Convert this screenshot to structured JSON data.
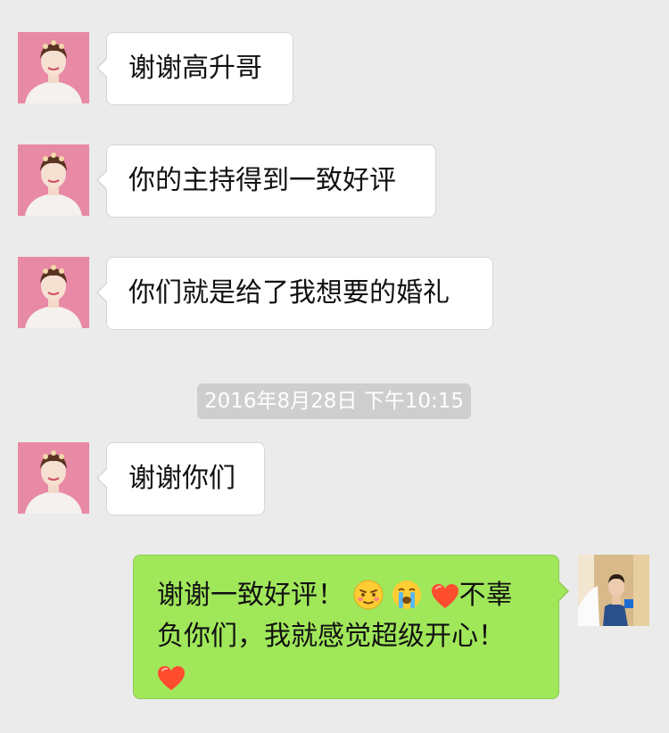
{
  "messages": [
    {
      "sender": "bride",
      "text": "谢谢高升哥"
    },
    {
      "sender": "bride",
      "text": "你的主持得到一致好评"
    },
    {
      "sender": "bride",
      "text": "你们就是给了我想要的婚礼"
    },
    {
      "sender": "bride",
      "text": "谢谢你们"
    }
  ],
  "timestamp": "2016年8月28日 下午10:15",
  "reply": {
    "part1": "谢谢一致好评！",
    "emoji1": "embarrassed-smile-icon",
    "emoji2": "crying-icon",
    "emoji3": "heart-icon",
    "part2": "不辜负你们，我就感觉超级开心！",
    "emoji4": "heart-icon"
  },
  "colors": {
    "background": "#ebebeb",
    "incoming_bubble": "#ffffff",
    "outgoing_bubble": "#a0e75a",
    "timestamp_bg": "#cecece",
    "heart": "#ff4d2e"
  }
}
